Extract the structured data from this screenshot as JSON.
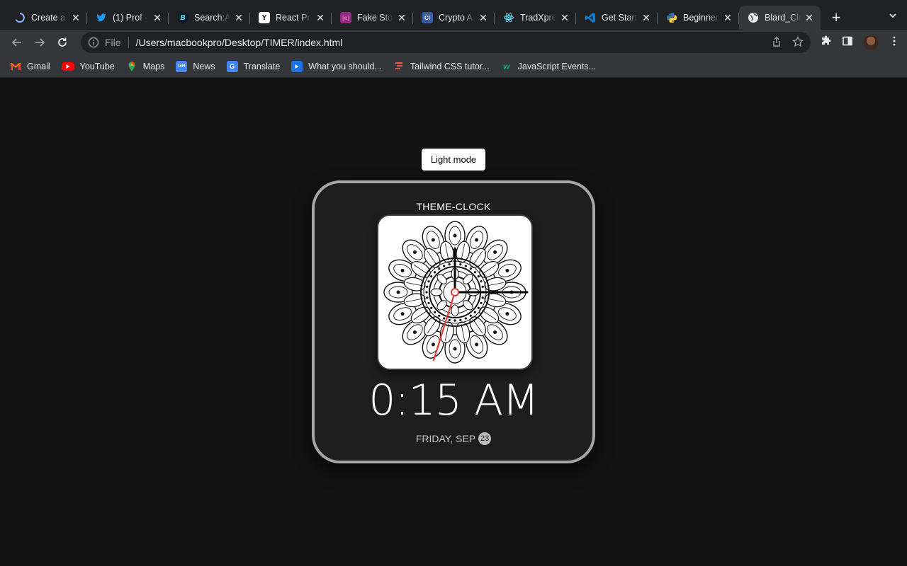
{
  "browser": {
    "tabs": [
      {
        "title": "Create a",
        "icon": "loading-spinner-icon",
        "color": "#8ab4f8"
      },
      {
        "title": "(1) Prof -",
        "icon": "twitter-bird-icon",
        "color": "#1d9bf0"
      },
      {
        "title": "Search:A",
        "icon": "bold-b-icon",
        "color": "#0a1f2a"
      },
      {
        "title": "React Pr",
        "icon": "y-letter-icon",
        "color": "#ffffff"
      },
      {
        "title": "Fake Sto",
        "icon": "bracket-e-icon",
        "color": "#8a2d7e"
      },
      {
        "title": "Crypto A",
        "icon": "cl-letters-icon",
        "color": "#3b5ba5"
      },
      {
        "title": "TradXpre",
        "icon": "react-atom-icon",
        "color": "#61dafb"
      },
      {
        "title": "Get Start",
        "icon": "vscode-icon",
        "color": "#0a7ed6"
      },
      {
        "title": "Beginner",
        "icon": "python-icon",
        "color": "#3776ab"
      },
      {
        "title": "Blard_Clo",
        "icon": "globe-icon",
        "color": "#e8eaed",
        "active": true
      }
    ],
    "address": {
      "scheme_label": "File",
      "url": "/Users/macbookpro/Desktop/TIMER/index.html"
    },
    "bookmarks": [
      {
        "label": "Gmail",
        "icon": "gmail-icon"
      },
      {
        "label": "YouTube",
        "icon": "youtube-icon"
      },
      {
        "label": "Maps",
        "icon": "maps-icon"
      },
      {
        "label": "News",
        "icon": "news-icon"
      },
      {
        "label": "Translate",
        "icon": "translate-icon"
      },
      {
        "label": "What you should...",
        "icon": "video-play-icon"
      },
      {
        "label": "Tailwind CSS tutor...",
        "icon": "tailwind-icon"
      },
      {
        "label": "JavaScript Events...",
        "icon": "w-logo-icon"
      }
    ]
  },
  "page": {
    "toggle_label": "Light mode",
    "clock_title": "THEME-CLOCK",
    "time_text": "0:15 AM",
    "date_text": "FRIDAY, SEP",
    "date_day": "23"
  },
  "colors": {
    "background": "#121212",
    "card_border": "#a6a6a6",
    "second_hand": "#e53935"
  }
}
